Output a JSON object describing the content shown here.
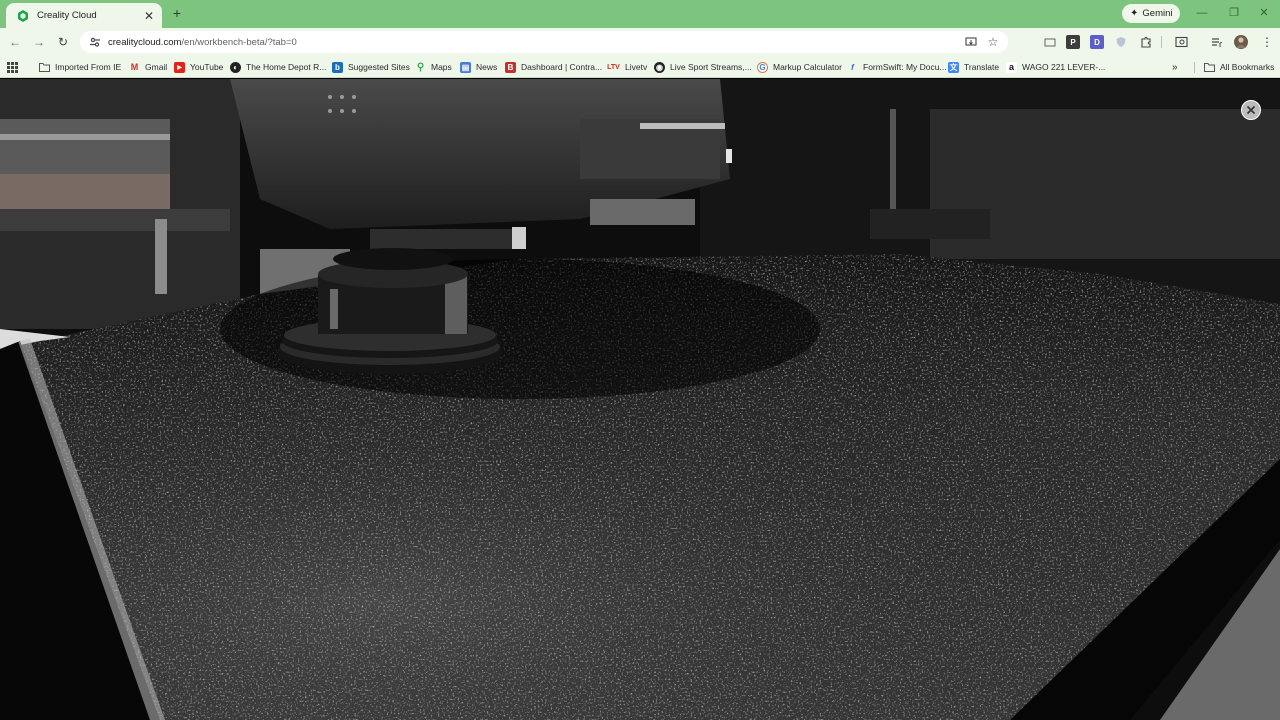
{
  "browser": {
    "tab": {
      "title": "Creality Cloud"
    },
    "gemini_label": "Gemini",
    "address": {
      "domain": "crealitycloud.com",
      "path": "/en/workbench-beta/?tab=0"
    }
  },
  "bookmarks": [
    {
      "label": "Imported From IE",
      "icon": "folder-icon"
    },
    {
      "label": "Gmail",
      "icon": "gmail-icon"
    },
    {
      "label": "YouTube",
      "icon": "youtube-icon"
    },
    {
      "label": "The Home Depot R...",
      "icon": "homedepot-icon"
    },
    {
      "label": "Suggested Sites",
      "icon": "bing-icon"
    },
    {
      "label": "Maps",
      "icon": "maps-icon"
    },
    {
      "label": "News",
      "icon": "news-icon"
    },
    {
      "label": "Dashboard | Contra...",
      "icon": "dashboard-icon"
    },
    {
      "label": "Livetv",
      "icon": "livetv-icon"
    },
    {
      "label": "Live Sport Streams,...",
      "icon": "sport-icon"
    },
    {
      "label": "Markup Calculator",
      "icon": "calculator-icon"
    },
    {
      "label": "FormSwift: My Docu...",
      "icon": "formswift-icon"
    },
    {
      "label": "Translate",
      "icon": "translate-icon"
    },
    {
      "label": "WAGO 221 LEVER-...",
      "icon": "amazon-icon"
    }
  ],
  "all_bookmarks_label": "All Bookmarks",
  "colors": {
    "tabstrip": "#7dc47e",
    "toolbar": "#eef7ea"
  }
}
